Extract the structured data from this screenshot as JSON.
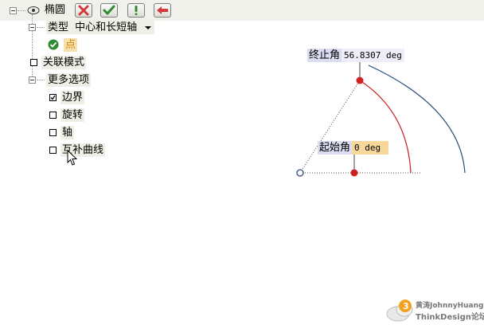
{
  "tree": {
    "root_label": "椭圆",
    "type_prefix": "类型",
    "type_value": "中心和长短轴",
    "point_label": "点",
    "assoc_mode_label": "关联模式",
    "more_options_label": "更多选项",
    "options": [
      {
        "label": "边界",
        "checked": true
      },
      {
        "label": "旋转",
        "checked": false
      },
      {
        "label": "轴",
        "checked": false
      },
      {
        "label": "互补曲线",
        "checked": false
      }
    ]
  },
  "toolbar": {
    "buttons": [
      {
        "name": "cancel",
        "icon": "x-icon",
        "color": "#d23a3a"
      },
      {
        "name": "ok",
        "icon": "check-icon",
        "color": "#2e8a2e"
      },
      {
        "name": "apply",
        "icon": "exclamation-icon",
        "color": "#2e8a2e"
      },
      {
        "name": "back",
        "icon": "arrow-left-icon",
        "color": "#d23a3a"
      }
    ]
  },
  "canvas": {
    "end_angle_label": "终止角",
    "end_angle_value": "56.8307 deg",
    "start_angle_label": "起始角",
    "start_angle_value": "0 deg",
    "arc_color": "#cc2222",
    "curve_color": "#2a4a7a"
  },
  "watermark": {
    "line1": "黄涛JohnnyHuang",
    "line2": "ThinkDesign论坛"
  }
}
